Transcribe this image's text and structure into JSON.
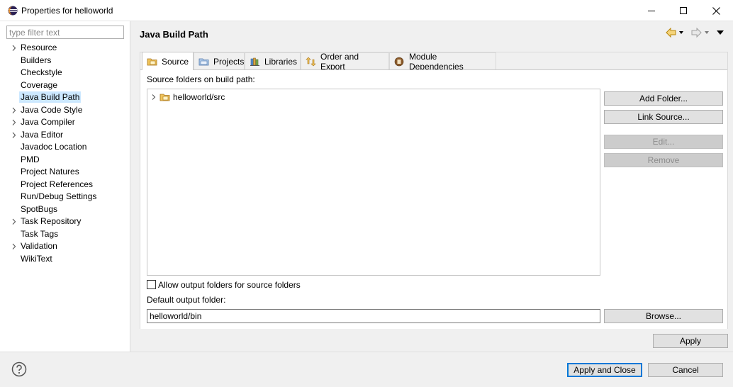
{
  "window": {
    "title": "Properties for helloworld",
    "controls": [
      "minimize-icon",
      "maximize-icon",
      "close-icon"
    ]
  },
  "filter": {
    "placeholder": "type filter text"
  },
  "tree": {
    "items": [
      {
        "label": "Resource",
        "expandable": true
      },
      {
        "label": "Builders",
        "expandable": false
      },
      {
        "label": "Checkstyle",
        "expandable": false
      },
      {
        "label": "Coverage",
        "expandable": false
      },
      {
        "label": "Java Build Path",
        "expandable": false,
        "selected": true
      },
      {
        "label": "Java Code Style",
        "expandable": true
      },
      {
        "label": "Java Compiler",
        "expandable": true
      },
      {
        "label": "Java Editor",
        "expandable": true
      },
      {
        "label": "Javadoc Location",
        "expandable": false
      },
      {
        "label": "PMD",
        "expandable": false
      },
      {
        "label": "Project Natures",
        "expandable": false
      },
      {
        "label": "Project References",
        "expandable": false
      },
      {
        "label": "Run/Debug Settings",
        "expandable": false
      },
      {
        "label": "SpotBugs",
        "expandable": false
      },
      {
        "label": "Task Repository",
        "expandable": true
      },
      {
        "label": "Task Tags",
        "expandable": false
      },
      {
        "label": "Validation",
        "expandable": true
      },
      {
        "label": "WikiText",
        "expandable": false
      }
    ]
  },
  "page": {
    "title": "Java Build Path",
    "tabs": [
      {
        "label": "Source",
        "icon": "source-folder-icon",
        "active": true
      },
      {
        "label": "Projects",
        "icon": "projects-icon"
      },
      {
        "label": "Libraries",
        "icon": "libraries-icon"
      },
      {
        "label": "Order and Export",
        "icon": "order-export-icon"
      },
      {
        "label": "Module Dependencies",
        "icon": "module-dependencies-icon"
      }
    ],
    "source": {
      "list_label": "Source folders on build path:",
      "folders": [
        "helloworld/src"
      ],
      "buttons": {
        "add_folder": "Add Folder...",
        "link_source": "Link Source...",
        "edit": "Edit...",
        "remove": "Remove"
      },
      "allow_output_label": "Allow output folders for source folders",
      "allow_output_checked": false,
      "output_label": "Default output folder:",
      "output_value": "helloworld/bin",
      "browse": "Browse..."
    },
    "apply": "Apply"
  },
  "footer": {
    "apply_close": "Apply and Close",
    "cancel": "Cancel"
  },
  "colors": {
    "selection": "#cce8ff",
    "default_button_border": "#0078d7"
  }
}
